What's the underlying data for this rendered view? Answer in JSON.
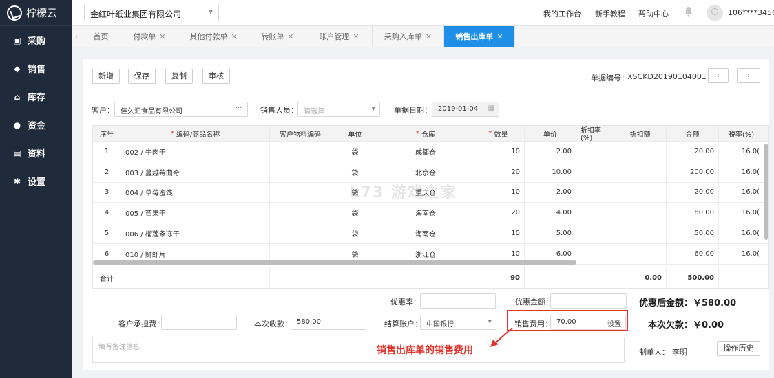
{
  "app": {
    "name": "柠檬云"
  },
  "sidebar": {
    "items": [
      {
        "label": "采购",
        "icon": "bag-icon"
      },
      {
        "label": "销售",
        "icon": "diamond-icon"
      },
      {
        "label": "库存",
        "icon": "warehouse-icon"
      },
      {
        "label": "资金",
        "icon": "coin-icon"
      },
      {
        "label": "资料",
        "icon": "document-icon"
      },
      {
        "label": "设置",
        "icon": "gear-icon"
      }
    ]
  },
  "topbar": {
    "company": "金红叶纸业集团有限公司",
    "links": [
      "我的工作台",
      "新手教程",
      "帮助中心"
    ],
    "user": "106****3456"
  },
  "tabs": [
    {
      "label": "首页",
      "closable": false
    },
    {
      "label": "付款单",
      "closable": true
    },
    {
      "label": "其他付款单",
      "closable": true
    },
    {
      "label": "转账单",
      "closable": true
    },
    {
      "label": "账户管理",
      "closable": true
    },
    {
      "label": "采购入库单",
      "closable": true
    },
    {
      "label": "销售出库单",
      "closable": true,
      "active": true
    }
  ],
  "toolbar": {
    "buttons": [
      "新增",
      "保存",
      "复制",
      "审核"
    ],
    "doc_no_label": "单据编号：",
    "doc_no": "XSCKD20190104001",
    "prev": "‹",
    "next": "›"
  },
  "form": {
    "customer_label": "客户：",
    "customer": "佳久汇食品有限公司",
    "customer_more": "···",
    "salesperson_label": "销售人员：",
    "salesperson_placeholder": "请选择",
    "date_label": "单据日期：",
    "date": "2019-01-04"
  },
  "table": {
    "headers": [
      "序号",
      "编码/商品名称",
      "客户物料编码",
      "单位",
      "仓库",
      "数量",
      "单价",
      "折扣率(%)",
      "折扣额",
      "金额",
      "税率(%)"
    ],
    "rows": [
      [
        "1",
        "002 / 牛肉干",
        "",
        "袋",
        "成都仓",
        "10",
        "2.00",
        "",
        "",
        "20.00",
        "16.0("
      ],
      [
        "2",
        "003 / 蔓越莓曲奇",
        "",
        "袋",
        "北京仓",
        "20",
        "10.00",
        "",
        "",
        "200.00",
        "16.0("
      ],
      [
        "3",
        "004 / 草莓蜜饯",
        "",
        "袋",
        "重庆仓",
        "10",
        "2.00",
        "",
        "",
        "20.00",
        "16.0("
      ],
      [
        "4",
        "005 / 芒果干",
        "",
        "袋",
        "海南仓",
        "20",
        "4.00",
        "",
        "",
        "80.00",
        "16.0("
      ],
      [
        "5",
        "006 / 榴莲条冻干",
        "",
        "袋",
        "海南仓",
        "10",
        "5.00",
        "",
        "",
        "50.00",
        "16.0("
      ],
      [
        "6",
        "010 / 鲜虾片",
        "",
        "袋",
        "浙江仓",
        "10",
        "6.00",
        "",
        "",
        "60.00",
        "16.0("
      ]
    ],
    "total_label": "合计",
    "total_qty": "90",
    "total_discount": "0.00",
    "total_amount": "500.00"
  },
  "footer": {
    "discount_rate_label": "优惠率：",
    "discount_amount_label": "优惠金额：",
    "after_discount": "优惠后金额：￥580.00",
    "customer_fee_label": "客户承担费：",
    "received_label": "本次收款：",
    "received": "580.00",
    "account_label": "结算账户：",
    "account": "中国银行",
    "sales_fee_label": "销售费用：",
    "sales_fee": "70.00",
    "set_label": "设置",
    "debt": "本次欠款：￥0.00",
    "memo_placeholder": "填写备注信息",
    "maker_label": "制单人：",
    "maker": "李明",
    "history": "操作历史"
  },
  "annotation": "销售出库单的销售费用",
  "watermark": "k73 游戏之家"
}
